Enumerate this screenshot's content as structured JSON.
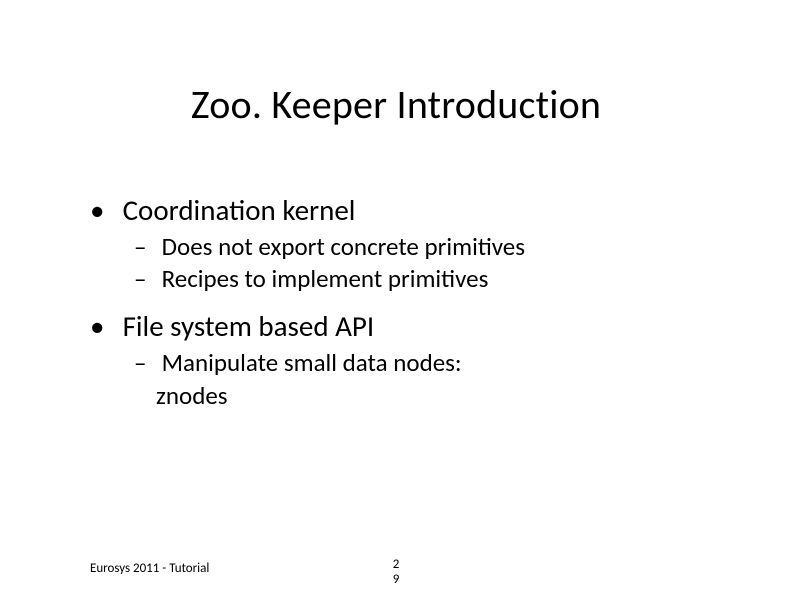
{
  "title": "Zoo. Keeper Introduction",
  "bullets": {
    "b1": "Coordination kernel",
    "b1a": "Does not export concrete primitives",
    "b1b": "Recipes to implement primitives",
    "b2": "File system based API",
    "b2a": "Manipulate small data nodes:",
    "b2a_em": "znodes"
  },
  "footer": {
    "left": "Eurosys 2011 - Tutorial",
    "page_top": "2",
    "page_bottom": "9"
  }
}
